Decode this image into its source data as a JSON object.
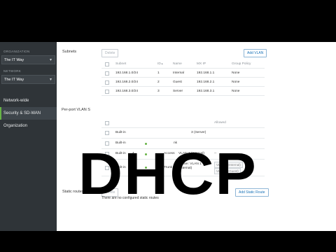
{
  "sidebar": {
    "org_section": "ORGANIZATION",
    "org_value": "The IT Way",
    "net_section": "NETWORK",
    "net_value": "The IT Way",
    "items": [
      {
        "label": "Network-wide"
      },
      {
        "label": "Security & SD-WAN"
      },
      {
        "label": "Organization"
      }
    ],
    "accent": "#67b346"
  },
  "subnets": {
    "title": "Subnets",
    "delete_label": "Delete",
    "add_label": "Add VLAN",
    "headers": [
      "Subnet",
      "ID",
      "Name",
      "MX IP",
      "Group Policy"
    ],
    "sort_indicator": "▲",
    "rows": [
      {
        "subnet": "192.168.1.0/24",
        "id": "1",
        "name": "Internal",
        "mxip": "192.168.1.1",
        "policy": "None"
      },
      {
        "subnet": "192.168.2.0/24",
        "id": "2",
        "name": "Guest",
        "mxip": "192.168.2.1",
        "policy": "None"
      },
      {
        "subnet": "192.168.3.0/24",
        "id": "3",
        "name": "Server",
        "mxip": "192.168.3.1",
        "policy": "None"
      }
    ]
  },
  "ports": {
    "title": "Per-port VLAN S",
    "allowed_header": "Allowed",
    "rows": [
      {
        "type": "Built-in",
        "vlan_text": "3 (Server)"
      },
      {
        "type": "Built-in",
        "mode": "nk"
      },
      {
        "type": "Built-in",
        "num": "4",
        "mode": "Access",
        "vlan_text": "VLAN 1 (Internal)",
        "allowed": "--"
      },
      {
        "type": "Built-in",
        "num": "5",
        "mode": "Trunk",
        "vlan_text": "Native: VLAN 1 (Internal)",
        "allowed_tags": [
          "VLAN 1 (Internal)",
          "VLAN 2 (Guest)"
        ]
      }
    ]
  },
  "static_routes": {
    "title": "Static routes",
    "delete_label": "Delete",
    "add_label": "Add Static Route",
    "empty_text": "There are no configured static routes"
  },
  "overlay_text": "DHCP"
}
